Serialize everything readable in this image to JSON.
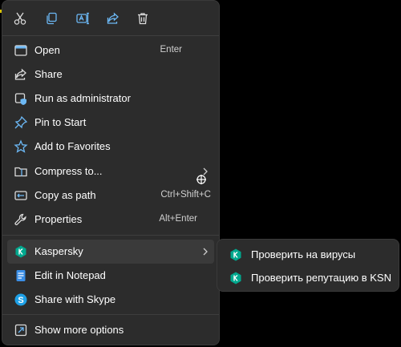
{
  "toolbar": {
    "icons": [
      "cut-icon",
      "copy-icon",
      "rename-icon",
      "share-icon",
      "delete-icon"
    ]
  },
  "menu": {
    "open": {
      "label": "Open",
      "shortcut": "Enter"
    },
    "share": {
      "label": "Share"
    },
    "run_admin": {
      "label": "Run as administrator"
    },
    "pin_start": {
      "label": "Pin to Start"
    },
    "favorites": {
      "label": "Add to Favorites"
    },
    "compress": {
      "label": "Compress to..."
    },
    "copy_path": {
      "label": "Copy as path",
      "shortcut": "Ctrl+Shift+C"
    },
    "properties": {
      "label": "Properties",
      "shortcut": "Alt+Enter"
    },
    "kaspersky": {
      "label": "Kaspersky"
    },
    "notepad": {
      "label": "Edit in Notepad"
    },
    "skype": {
      "label": "Share with Skype"
    },
    "more_options": {
      "label": "Show more options"
    }
  },
  "submenu": {
    "scan": {
      "label": "Проверить на вирусы"
    },
    "reputation": {
      "label": "Проверить репутацию в KSN"
    }
  },
  "colors": {
    "menu_bg": "#2c2c2c",
    "hover_bg": "#3a3a3a",
    "accent_blue": "#6cb8f5",
    "kaspersky_green": "#00a88e"
  }
}
